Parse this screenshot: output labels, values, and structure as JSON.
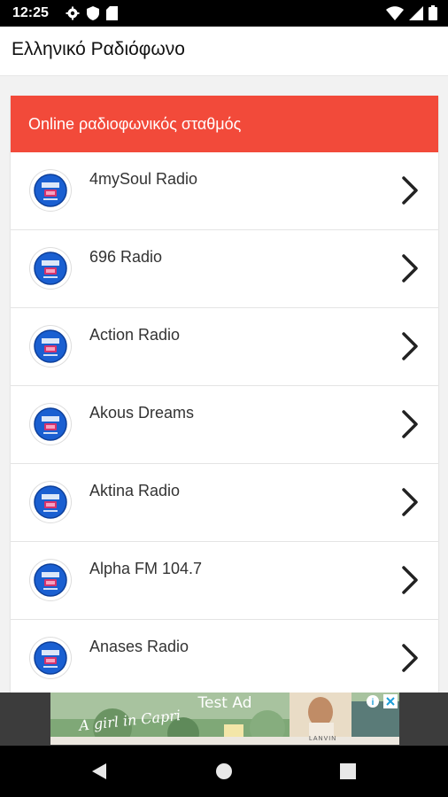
{
  "status_bar": {
    "time": "12:25",
    "left_icons": [
      "gear-icon",
      "shield-icon",
      "sd-card-icon"
    ],
    "right_icons": [
      "wifi-icon",
      "signal-icon",
      "battery-icon"
    ]
  },
  "app_bar": {
    "title": "Ελληνικό Ραδιόφωνο"
  },
  "list": {
    "header": "Online ραδιοφωνικός σταθμός",
    "accent_color": "#f24a3a",
    "stations": [
      {
        "name": "4mySoul Radio"
      },
      {
        "name": "696 Radio"
      },
      {
        "name": "Action Radio"
      },
      {
        "name": "Akous Dreams"
      },
      {
        "name": "Aktina Radio"
      },
      {
        "name": "Alpha FM 104.7"
      },
      {
        "name": "Anases Radio"
      }
    ]
  },
  "ad": {
    "label": "Test Ad",
    "script_text": "A girl in Capri",
    "brand": "LANVIN"
  },
  "nav_bar": {
    "buttons": [
      "back-icon",
      "home-icon",
      "recents-icon"
    ]
  }
}
